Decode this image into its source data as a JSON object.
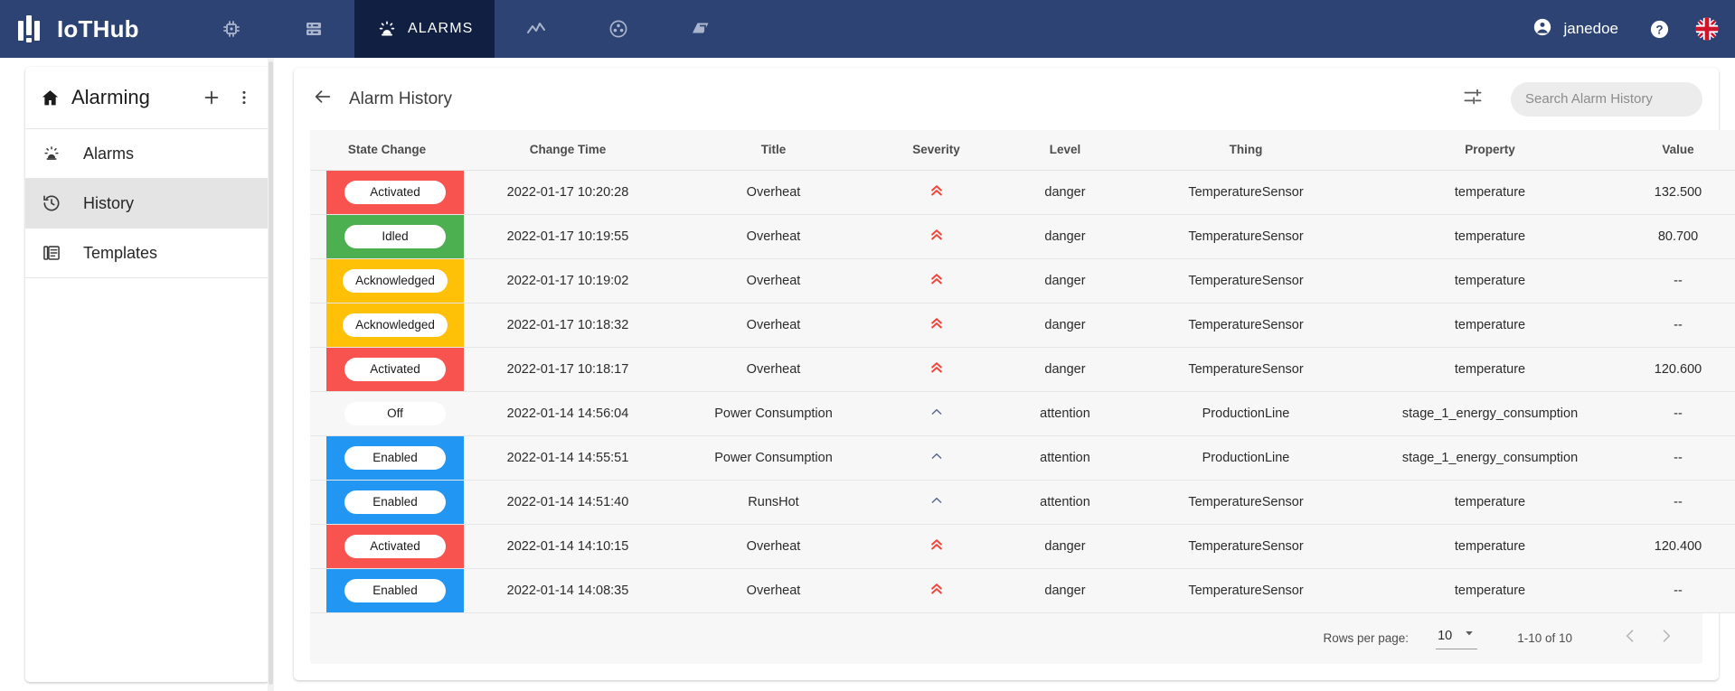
{
  "topbar": {
    "brand": "IoTHub",
    "nav": [
      {
        "name": "nav-things",
        "icon": "chip-icon",
        "label": ""
      },
      {
        "name": "nav-data",
        "icon": "server-icon",
        "label": ""
      },
      {
        "name": "nav-alarms",
        "icon": "alarm-light-icon",
        "label": "ALARMS",
        "active": true
      },
      {
        "name": "nav-analytics",
        "icon": "line-chart-icon",
        "label": ""
      },
      {
        "name": "nav-users",
        "icon": "users-group-icon",
        "label": ""
      },
      {
        "name": "nav-flows",
        "icon": "flow-icon",
        "label": ""
      }
    ],
    "user": "janedoe",
    "help_icon": "help-circle-icon",
    "language_icon": "uk-flag-icon",
    "accent_active_bg": "#101f42",
    "bar_bg": "#2d4373"
  },
  "sidebar": {
    "title": "Alarming",
    "home_icon": "home-icon",
    "add_label": "+",
    "more_label": "⋮",
    "items": [
      {
        "label": "Alarms",
        "icon": "alarm-light-icon",
        "selected": false
      },
      {
        "label": "History",
        "icon": "history-icon",
        "selected": true
      },
      {
        "label": "Templates",
        "icon": "templates-icon",
        "selected": false
      }
    ]
  },
  "content": {
    "back_icon": "arrow-left-icon",
    "page_title": "Alarm History",
    "filter_icon": "filter-settings-icon",
    "search": {
      "placeholder": "Search Alarm History",
      "value": ""
    }
  },
  "table": {
    "columns": [
      "State Change",
      "Change Time",
      "Title",
      "Severity",
      "Level",
      "Thing",
      "Property",
      "Value"
    ],
    "state_colors": {
      "Activated": "#f9534f",
      "Idled": "#4caf50",
      "Acknowledged": "#ffc107",
      "Enabled": "#2196f3",
      "Off": "#f7f7f7"
    },
    "severity_colors": {
      "danger": "#f44336",
      "attention": "#5a6a8c"
    },
    "rows": [
      {
        "state": "Activated",
        "time": "2022-01-17 10:20:28",
        "title": "Overheat",
        "severity": "danger",
        "severity_icon": "double-chevron-up-icon",
        "level": "danger",
        "thing": "TemperatureSensor",
        "property": "temperature",
        "value": "132.500"
      },
      {
        "state": "Idled",
        "time": "2022-01-17 10:19:55",
        "title": "Overheat",
        "severity": "danger",
        "severity_icon": "double-chevron-up-icon",
        "level": "danger",
        "thing": "TemperatureSensor",
        "property": "temperature",
        "value": "80.700"
      },
      {
        "state": "Acknowledged",
        "time": "2022-01-17 10:19:02",
        "title": "Overheat",
        "severity": "danger",
        "severity_icon": "double-chevron-up-icon",
        "level": "danger",
        "thing": "TemperatureSensor",
        "property": "temperature",
        "value": "--"
      },
      {
        "state": "Acknowledged",
        "time": "2022-01-17 10:18:32",
        "title": "Overheat",
        "severity": "danger",
        "severity_icon": "double-chevron-up-icon",
        "level": "danger",
        "thing": "TemperatureSensor",
        "property": "temperature",
        "value": "--"
      },
      {
        "state": "Activated",
        "time": "2022-01-17 10:18:17",
        "title": "Overheat",
        "severity": "danger",
        "severity_icon": "double-chevron-up-icon",
        "level": "danger",
        "thing": "TemperatureSensor",
        "property": "temperature",
        "value": "120.600"
      },
      {
        "state": "Off",
        "time": "2022-01-14 14:56:04",
        "title": "Power Consumption",
        "severity": "attention",
        "severity_icon": "chevron-up-icon",
        "level": "attention",
        "thing": "ProductionLine",
        "property": "stage_1_energy_consumption",
        "value": "--"
      },
      {
        "state": "Enabled",
        "time": "2022-01-14 14:55:51",
        "title": "Power Consumption",
        "severity": "attention",
        "severity_icon": "chevron-up-icon",
        "level": "attention",
        "thing": "ProductionLine",
        "property": "stage_1_energy_consumption",
        "value": "--"
      },
      {
        "state": "Enabled",
        "time": "2022-01-14 14:51:40",
        "title": "RunsHot",
        "severity": "attention",
        "severity_icon": "chevron-up-icon",
        "level": "attention",
        "thing": "TemperatureSensor",
        "property": "temperature",
        "value": "--"
      },
      {
        "state": "Activated",
        "time": "2022-01-14 14:10:15",
        "title": "Overheat",
        "severity": "danger",
        "severity_icon": "double-chevron-up-icon",
        "level": "danger",
        "thing": "TemperatureSensor",
        "property": "temperature",
        "value": "120.400"
      },
      {
        "state": "Enabled",
        "time": "2022-01-14 14:08:35",
        "title": "Overheat",
        "severity": "danger",
        "severity_icon": "double-chevron-up-icon",
        "level": "danger",
        "thing": "TemperatureSensor",
        "property": "temperature",
        "value": "--"
      }
    ]
  },
  "paginator": {
    "rows_per_page_label": "Rows per page:",
    "rows_per_page_value": "10",
    "range": "1-10 of 10",
    "prev_icon": "chevron-left-icon",
    "next_icon": "chevron-right-icon"
  }
}
